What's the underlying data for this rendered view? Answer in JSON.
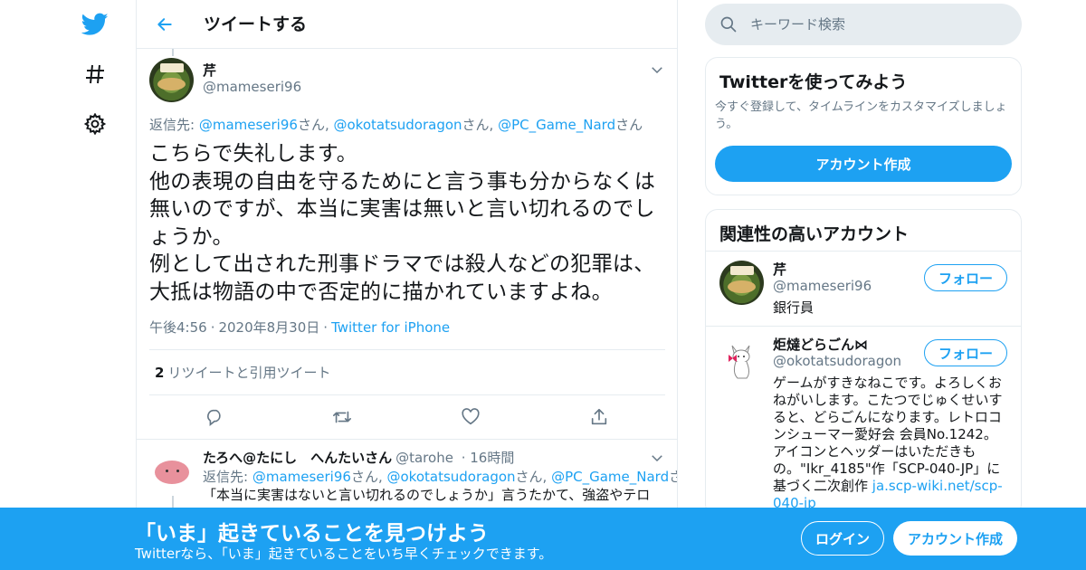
{
  "nav": {
    "logo": "twitter-bird-icon",
    "explore": "hashtag-icon",
    "settings": "gear-icon"
  },
  "header": {
    "title": "ツイートする"
  },
  "tweet": {
    "author_name": "芹",
    "author_handle": "@mameseri96",
    "reply_prefix": "返信先: ",
    "reply_to": [
      {
        "handle": "@mameseri96",
        "suffix": "さん, "
      },
      {
        "handle": "@okotatsudoragon",
        "suffix": "さん, "
      },
      {
        "handle": "@PC_Game_Nard",
        "suffix": "さん"
      }
    ],
    "text": "こちらで失礼します。\n他の表現の自由を守るためにと言う事も分からなくは無いのですが、本当に実害は無いと言い切れるのでしょうか。\n例として出された刑事ドラマでは殺人などの犯罪は、大抵は物語の中で否定的に描かれていますよね。",
    "time": "午後4:56",
    "date": "2020年8月30日",
    "source": "Twitter for iPhone",
    "retweet_count": "2",
    "retweet_label": "リツイートと引用ツイート"
  },
  "reply": {
    "author_name": "たろへ@たにし　へんたいさん",
    "author_handle": "@tarohe",
    "time": "16時間",
    "reply_prefix": "返信先: ",
    "reply_to": [
      {
        "handle": "@mameseri96",
        "suffix": "さん, "
      },
      {
        "handle": "@okotatsudoragon",
        "suffix": "さん, "
      },
      {
        "handle": "@PC_Game_Nard",
        "suffix": "さん"
      }
    ],
    "text": "「本当に実害はないと言い切れるのでしょうか」言うたかて、強盗やテロ"
  },
  "search": {
    "placeholder": "キーワード検索"
  },
  "signup_card": {
    "title": "Twitterを使ってみよう",
    "desc": "今すぐ登録して、タイムラインをカスタマイズしましょう。",
    "button": "アカウント作成"
  },
  "related": {
    "title": "関連性の高いアカウント",
    "accounts": [
      {
        "name": "芹",
        "handle": "@mameseri96",
        "bio": "銀行員",
        "follow": "フォロー"
      },
      {
        "name": "炬燵どらごん⋈",
        "handle": "@okotatsudoragon",
        "bio": "ゲームがすきなねこです。よろしくおねがいします。こたつでじゅくせいすると、どらごんになります。レトロコンシューマー愛好会 会員No.1242。アイコンとヘッダーはいただきもの。\"Ikr_4185\"作「SCP-040-JP」に基づく二次創作 ",
        "bio_link": "ja.scp-wiki.net/scp-040-jp",
        "follow": "フォロー"
      }
    ]
  },
  "banner": {
    "title": "「いま」起きていることを見つけよう",
    "subtitle": "Twitterなら、「いま」起きていることをいち早くチェックできます。",
    "login": "ログイン",
    "signup": "アカウント作成"
  },
  "colors": {
    "accent": "#1da1f2",
    "secondary_text": "#657786",
    "border": "#e6ecf0"
  }
}
